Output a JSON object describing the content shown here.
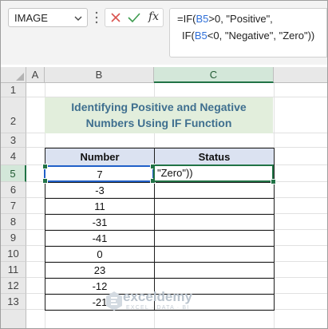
{
  "name_box": {
    "value": "IMAGE"
  },
  "formula_bar": {
    "line1_prefix": "=IF(",
    "line1_ref": "B5",
    "line1_suffix": ">0, \"Positive\",",
    "line2_prefix": "IF(",
    "line2_ref": "B5",
    "line2_suffix": "<0, \"Negative\", \"Zero\"))"
  },
  "icons": {
    "cancel": "close-icon",
    "enter": "check-icon",
    "function": "fx-icon"
  },
  "fx_label": "fx",
  "columns": [
    "A",
    "B",
    "C"
  ],
  "rows": [
    "1",
    "2",
    "3",
    "4",
    "5",
    "6",
    "7",
    "8",
    "9",
    "10",
    "11",
    "12",
    "13"
  ],
  "title": {
    "line1": "Identifying Positive and Negative",
    "line2": "Numbers Using IF Function"
  },
  "table": {
    "headers": [
      "Number",
      "Status"
    ],
    "numbers": [
      "7",
      "-3",
      "11",
      "-31",
      "-41",
      "0",
      "23",
      "-12",
      "-21"
    ],
    "status": [
      "\"Zero\"))",
      "",
      "",
      "",
      "",
      "",
      "",
      "",
      ""
    ]
  },
  "watermark": {
    "brand": "exceldemy",
    "tagline": "EXCEL · DATA · BI"
  },
  "colors": {
    "accent_green": "#217346",
    "selection_blue": "#2060c8",
    "title_bg": "#e2eedc",
    "title_text": "#3f6f8f",
    "header_bg": "#dbe2f1"
  }
}
